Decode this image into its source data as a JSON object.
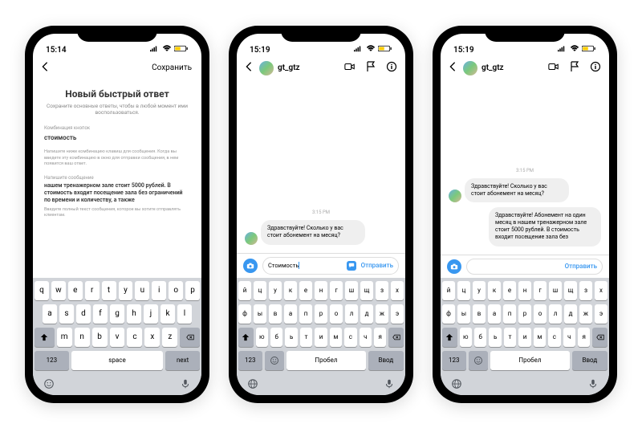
{
  "phone1": {
    "time": "15:14",
    "nav": {
      "save": "Сохранить"
    },
    "qr": {
      "title": "Новый быстрый ответ",
      "subtitle": "Сохраните основные ответы, чтобы в любой момент ими воспользоваться.",
      "shortcut_label": "Комбинация кнопок",
      "shortcut_value": "стоимость",
      "shortcut_hint": "Напишите ниже комбинацию клавиш для сообщения. Когда вы введете эту комбинацию в окно для отправки сообщения, в нем появится ваш ответ.",
      "message_label": "Напишите сообщение",
      "message": "нашем тренажерном зале стоит 5000 рублей. В стоимость входит посещение зала без ограничений по времени и количеству, а также",
      "message_hint": "Введите полный текст сообщения, которое вы хотите отправлять клиентам."
    },
    "keyboard": {
      "row1": [
        "q",
        "w",
        "e",
        "r",
        "t",
        "y",
        "u",
        "i",
        "o",
        "p"
      ],
      "row2": [
        "a",
        "s",
        "d",
        "f",
        "g",
        "h",
        "j",
        "k",
        "l"
      ],
      "row3": [
        "z",
        "x",
        "c",
        "v",
        "b",
        "n",
        "m"
      ],
      "num": "123",
      "space": "space",
      "next": "next"
    }
  },
  "phone2": {
    "time": "15:19",
    "user": "gt_gtz",
    "timestamp": "3:15 PM",
    "incoming": "Здравствуйте! Сколько у вас стоит абонемент на месяц?",
    "composer": {
      "text": "Стоимость",
      "send": "Отправить"
    },
    "keyboard": {
      "row1": [
        "й",
        "ц",
        "у",
        "к",
        "е",
        "н",
        "г",
        "ш",
        "щ",
        "з",
        "х"
      ],
      "row2": [
        "ф",
        "ы",
        "в",
        "а",
        "п",
        "р",
        "о",
        "л",
        "д",
        "ж",
        "э"
      ],
      "row3": [
        "я",
        "ч",
        "с",
        "м",
        "и",
        "т",
        "ь",
        "б",
        "ю"
      ],
      "num": "123",
      "space": "Пробел",
      "enter": "Ввод"
    }
  },
  "phone3": {
    "time": "15:19",
    "user": "gt_gtz",
    "timestamp": "3:15 PM",
    "incoming": "Здравствуйте! Сколько у вас стоит абонемент на месяц?",
    "outgoing": "Здравствуйте! Абонемент на один месяц в нашем тренажерном зале стоит 5000 рублей. В стоимость входит посещение зала без",
    "composer": {
      "send": "Отправить"
    },
    "keyboard": {
      "row1": [
        "й",
        "ц",
        "у",
        "к",
        "е",
        "н",
        "г",
        "ш",
        "щ",
        "з",
        "х"
      ],
      "row2": [
        "ф",
        "ы",
        "в",
        "а",
        "п",
        "р",
        "о",
        "л",
        "д",
        "ж",
        "э"
      ],
      "row3": [
        "я",
        "ч",
        "с",
        "м",
        "и",
        "т",
        "ь",
        "б",
        "ю"
      ],
      "num": "123",
      "space": "Пробел",
      "enter": "Ввод"
    }
  }
}
